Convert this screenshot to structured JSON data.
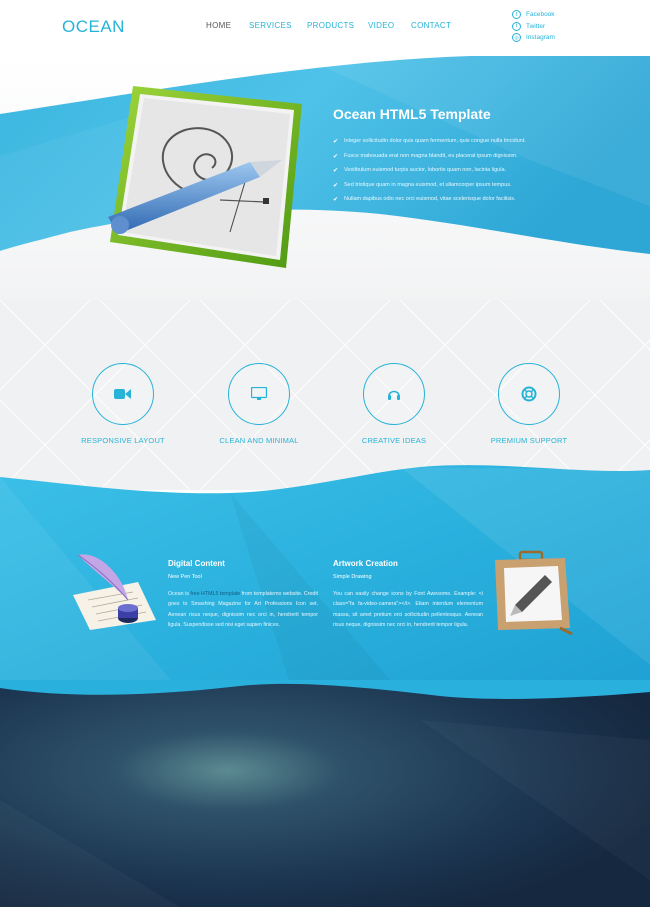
{
  "header": {
    "logo": "OCEAN",
    "nav": [
      {
        "label": "HOME"
      },
      {
        "label": "SERVICES"
      },
      {
        "label": "PRODUCTS"
      },
      {
        "label": "VIDEO"
      },
      {
        "label": "CONTACT"
      }
    ],
    "social": [
      {
        "label": "Facebook",
        "icon": "facebook-icon"
      },
      {
        "label": "Twitter",
        "icon": "twitter-icon"
      },
      {
        "label": "Instagram",
        "icon": "instagram-icon"
      }
    ]
  },
  "hero": {
    "title": "Ocean HTML5 Template",
    "items": [
      "Integer sollicitudin dolor quis quam fermentum, quis congue nulla tincidunt.",
      "Fusce malesuada erat non magna blandit, eu placerat ipsum dignissim.",
      "Vestibulum euismod turpis auctor, lobortis quam non, lacinia ligula.",
      "Sed tristique quam in magna euismod, et ullamcorper ipsum tempus.",
      "Nullam dapibus odio nec orci euismod, vitae scelerisque dolor facilisis."
    ]
  },
  "features": [
    {
      "title": "RESPONSIVE LAYOUT",
      "icon": "video-camera-icon"
    },
    {
      "title": "CLEAN AND MINIMAL",
      "icon": "monitor-icon"
    },
    {
      "title": "CREATIVE IDEAS",
      "icon": "headphones-icon"
    },
    {
      "title": "PREMIUM SUPPORT",
      "icon": "life-ring-icon"
    }
  ],
  "content": {
    "left": {
      "title": "Digital Content",
      "subtitle": "New Pen Tool",
      "body_pre": "Ocean is ",
      "body_link": "free HTML5 template",
      "body_post": " from templatemo website. Credit goes to Smashing Magazine for Art Professions Icon set. Aenean risus neque, dignissim nec orci in, hendrerit tempor ligula. Suspendisse sed nisi eget sapien finices."
    },
    "right": {
      "title": "Artwork Creation",
      "subtitle": "Simple Drawing",
      "body": "You can easily change icons by Font Awesome. Example: <i class=\"fa fa-video-camera\"></i>. Etiam interdum elementum massa, sit amet pretium orci sollicitudin pellentesque. Aenean risus neque, dignissim nec orci in, hendrerit tempor ligula."
    }
  },
  "colors": {
    "accent": "#27b3d8",
    "hero_blue": "#3fb4df",
    "dark": "#1b3550"
  }
}
